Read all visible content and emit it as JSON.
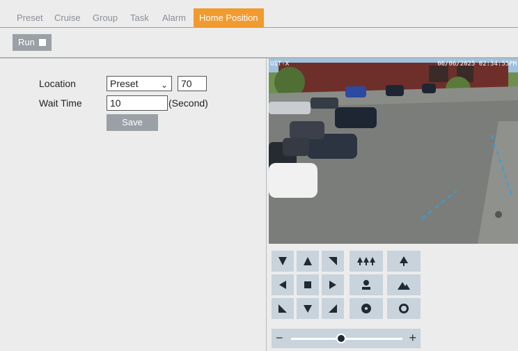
{
  "tabs": [
    {
      "label": "Preset"
    },
    {
      "label": "Cruise"
    },
    {
      "label": "Group"
    },
    {
      "label": "Task"
    },
    {
      "label": "Alarm"
    },
    {
      "label": "Home Position",
      "active": true
    }
  ],
  "run": {
    "label": "Run",
    "checked": false
  },
  "form": {
    "location_label": "Location",
    "location_select": "Preset",
    "location_value": "70",
    "wait_label": "Wait Time",
    "wait_value": "10",
    "wait_unit": "(Second)",
    "save_label": "Save"
  },
  "video": {
    "osd_left": "UIT-X",
    "osd_timestamp": "06/06/2025 02:34:55PM"
  },
  "ptz": {
    "directions": [
      "up-left",
      "up",
      "up-right",
      "left",
      "stop",
      "right",
      "down-left",
      "down",
      "down-right"
    ],
    "functions": [
      "zoom-out-trees",
      "zoom-in-tree",
      "focus-near",
      "focus-far",
      "iris-close",
      "iris-open"
    ],
    "zoom_level": 0.45
  },
  "colors": {
    "accent": "#f19a2e",
    "button": "#9aa0a6",
    "pad": "#c8d3dc"
  }
}
